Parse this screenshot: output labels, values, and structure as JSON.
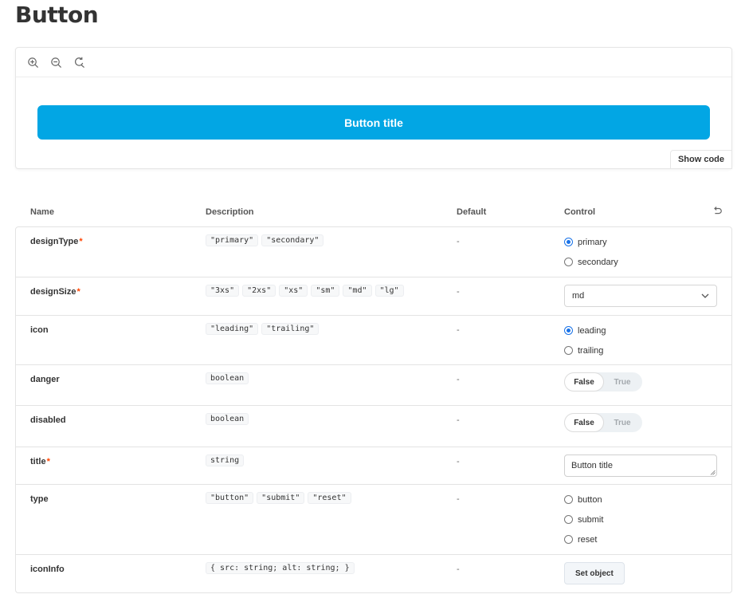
{
  "page": {
    "title": "Button"
  },
  "preview": {
    "toolbar": {
      "zoom_in": "zoom-in-icon",
      "zoom_out": "zoom-out-icon",
      "reset_zoom": "reset-zoom-icon"
    },
    "button_title": "Button title",
    "show_code": "Show code",
    "accent_color": "#02a6e4"
  },
  "args": {
    "headers": {
      "name": "Name",
      "description": "Description",
      "default": "Default",
      "control": "Control"
    },
    "rows": [
      {
        "name": "designType",
        "required": "*",
        "desc": [
          "\"primary\"",
          "\"secondary\""
        ],
        "default": "-",
        "control": {
          "type": "radio",
          "options": [
            "primary",
            "secondary"
          ],
          "selected": "primary"
        }
      },
      {
        "name": "designSize",
        "required": "*",
        "desc": [
          "\"3xs\"",
          "\"2xs\"",
          "\"xs\"",
          "\"sm\"",
          "\"md\"",
          "\"lg\""
        ],
        "default": "-",
        "control": {
          "type": "select",
          "value": "md"
        }
      },
      {
        "name": "icon",
        "required": "",
        "desc": [
          "\"leading\"",
          "\"trailing\""
        ],
        "default": "-",
        "control": {
          "type": "radio",
          "options": [
            "leading",
            "trailing"
          ],
          "selected": "leading"
        }
      },
      {
        "name": "danger",
        "required": "",
        "desc": [
          "boolean"
        ],
        "default": "-",
        "control": {
          "type": "toggle",
          "off": "False",
          "on": "True",
          "value": "False"
        }
      },
      {
        "name": "disabled",
        "required": "",
        "desc": [
          "boolean"
        ],
        "default": "-",
        "control": {
          "type": "toggle",
          "off": "False",
          "on": "True",
          "value": "False"
        }
      },
      {
        "name": "title",
        "required": "*",
        "desc": [
          "string"
        ],
        "default": "-",
        "control": {
          "type": "text",
          "value": "Button title"
        }
      },
      {
        "name": "type",
        "required": "",
        "desc": [
          "\"button\"",
          "\"submit\"",
          "\"reset\""
        ],
        "default": "-",
        "control": {
          "type": "radio",
          "options": [
            "button",
            "submit",
            "reset"
          ],
          "selected": ""
        }
      },
      {
        "name": "iconInfo",
        "required": "",
        "desc": [
          "{ src: string; alt: string; }"
        ],
        "default": "-",
        "control": {
          "type": "object",
          "label": "Set object"
        }
      }
    ]
  }
}
